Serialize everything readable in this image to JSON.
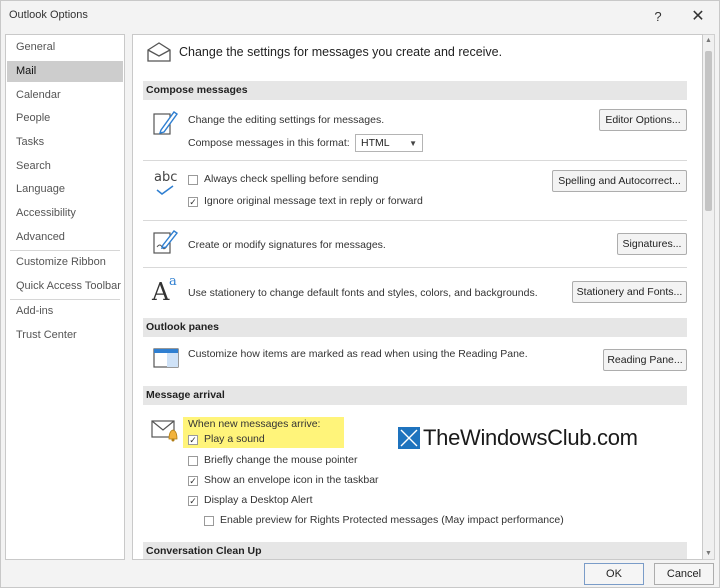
{
  "window": {
    "title": "Outlook Options",
    "help": "?",
    "close": "✕"
  },
  "sidebar": {
    "items": [
      {
        "label": "General"
      },
      {
        "label": "Mail"
      },
      {
        "label": "Calendar"
      },
      {
        "label": "People"
      },
      {
        "label": "Tasks"
      },
      {
        "label": "Search"
      },
      {
        "label": "Language"
      },
      {
        "label": "Accessibility"
      },
      {
        "label": "Advanced"
      },
      {
        "label": "Customize Ribbon"
      },
      {
        "label": "Quick Access Toolbar"
      },
      {
        "label": "Add-ins"
      },
      {
        "label": "Trust Center"
      }
    ],
    "selected": "Mail"
  },
  "main": {
    "heading": "Change the settings for messages you create and receive.",
    "compose": {
      "header": "Compose messages",
      "editing_text": "Change the editing settings for messages.",
      "format_label": "Compose messages in this format:",
      "format_value": "HTML",
      "editor_button": "Editor Options...",
      "spelling_check_label": "Always check spelling before sending",
      "spelling_check_checked": false,
      "ignore_original_label": "Ignore original message text in reply or forward",
      "ignore_original_checked": true,
      "spelling_button": "Spelling and Autocorrect...",
      "signatures_text": "Create or modify signatures for messages.",
      "signatures_button": "Signatures...",
      "stationery_text": "Use stationery to change default fonts and styles, colors, and backgrounds.",
      "stationery_button": "Stationery and Fonts...",
      "abc_icon_text": "abc",
      "stationery_icon_text": "A",
      "stationery_icon_sup": "a"
    },
    "panes": {
      "header": "Outlook panes",
      "text": "Customize how items are marked as read when using the Reading Pane.",
      "button": "Reading Pane..."
    },
    "arrival": {
      "header": "Message arrival",
      "intro": "When new messages arrive:",
      "options": [
        {
          "label": "Play a sound",
          "checked": true
        },
        {
          "label": "Briefly change the mouse pointer",
          "checked": false
        },
        {
          "label": "Show an envelope icon in the taskbar",
          "checked": true
        },
        {
          "label": "Display a Desktop Alert",
          "checked": true
        },
        {
          "label": "Enable preview for Rights Protected messages (May impact performance)",
          "checked": false
        }
      ]
    },
    "cleanup": {
      "header": "Conversation Clean Up"
    }
  },
  "watermark": {
    "text": "TheWindowsClub.com"
  },
  "footer": {
    "ok": "OK",
    "cancel": "Cancel"
  },
  "colors": {
    "highlight": "#fff47a",
    "accent_blue": "#2f7fd1",
    "selected_nav": "#cdcdcd"
  }
}
